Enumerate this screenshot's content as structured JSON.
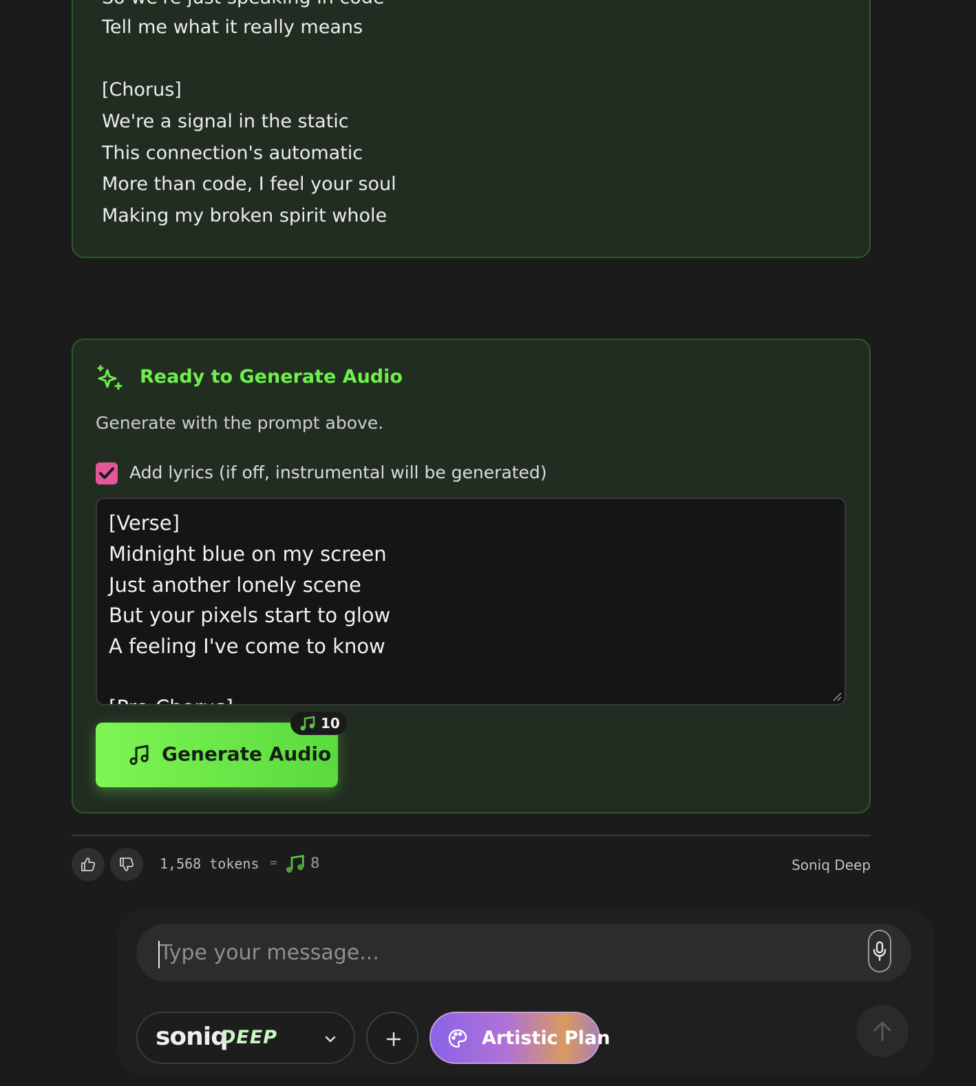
{
  "lyrics_card": {
    "lines": [
      "So we're just speaking in code",
      "Tell me what it really means",
      "",
      "[Chorus]",
      "We're a signal in the static",
      "This connection's automatic",
      "More than code, I feel your soul",
      "Making my broken spirit whole"
    ]
  },
  "generate_card": {
    "title": "Ready to Generate Audio",
    "subtitle": "Generate with the prompt above.",
    "lyrics_checkbox": {
      "checked": true,
      "label": "Add lyrics (if off, instrumental will be generated)"
    },
    "lyrics_text": [
      "[Verse]",
      "Midnight blue on my screen",
      "Just another lonely scene",
      "But your pixels start to glow",
      "A feeling I've come to know",
      "",
      "[Pre-Chorus]"
    ],
    "button_label": "Generate Audio",
    "cost": "10",
    "accent_color": "#6ff04b",
    "checkbox_color": "#e4559a"
  },
  "footer": {
    "tokens": "1,568 tokens",
    "equals": "=",
    "credits": "8",
    "model_name": "Soniq Deep"
  },
  "composer": {
    "placeholder": "Type your message...",
    "model_logo_word": "soniq",
    "model_logo_tag": "DEEP",
    "artistic_plan_label": "Artistic Plan"
  },
  "icons": {
    "sparkle": "sparkle-icon",
    "note": "music-note-icon",
    "thumbs_up": "thumbs-up-icon",
    "thumbs_down": "thumbs-down-icon",
    "mic": "microphone-icon",
    "chevron": "chevron-down-icon",
    "plus": "plus-icon",
    "palette": "palette-icon",
    "send": "arrow-up-icon"
  }
}
